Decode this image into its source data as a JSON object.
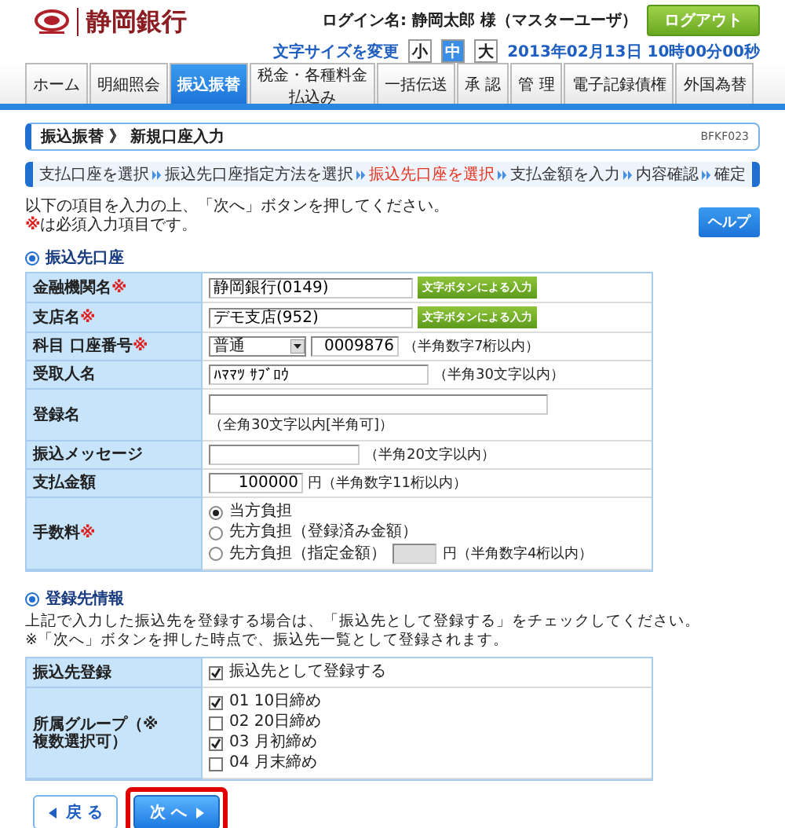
{
  "header": {
    "bank_name": "静岡銀行",
    "login_label": "ログイン名: 静岡太郎 様（マスターユーザ）",
    "logout": "ログアウト",
    "font_size_label": "文字サイズを変更",
    "font_sizes": [
      {
        "label": "小",
        "selected": false
      },
      {
        "label": "中",
        "selected": true
      },
      {
        "label": "大",
        "selected": false
      }
    ],
    "datetime": "2013年02月13日 10時00分00秒"
  },
  "nav": [
    {
      "label": "ホーム",
      "selected": false
    },
    {
      "label": "明細照会",
      "selected": false
    },
    {
      "label": "振込振替",
      "selected": true
    },
    {
      "label": "税金・各種料金払込み",
      "selected": false
    },
    {
      "label": "一括伝送",
      "selected": false
    },
    {
      "label": "承 認",
      "selected": false
    },
    {
      "label": "管 理",
      "selected": false
    },
    {
      "label": "電子記録債権",
      "selected": false
    },
    {
      "label": "外国為替",
      "selected": false
    }
  ],
  "page_title": {
    "title": "振込振替 》 新規口座入力",
    "screen_id": "BFKF023"
  },
  "steps": [
    {
      "label": "支払口座を選択",
      "current": false
    },
    {
      "label": "振込先口座指定方法を選択",
      "current": false
    },
    {
      "label": "振込先口座を選択",
      "current": true
    },
    {
      "label": "支払金額を入力",
      "current": false
    },
    {
      "label": "内容確認",
      "current": false
    },
    {
      "label": "確定",
      "current": false
    }
  ],
  "instructions": {
    "line": "以下の項目を入力の上、「次へ」ボタンを押してください。",
    "required_mark": "※",
    "required_text": "は必須入力項目です。"
  },
  "help_button": "ヘルプ",
  "account_section": {
    "heading": "振込先口座",
    "rows": [
      {
        "label": "金融機関名",
        "required_mark": "※",
        "kind": "text_button",
        "value": "静岡銀行(0149)",
        "button": "文字ボタンによる入力"
      },
      {
        "label": "支店名",
        "required_mark": "※",
        "kind": "text_button",
        "value": "デモ支店(952)",
        "button": "文字ボタンによる入力"
      },
      {
        "label": "科目 口座番号",
        "required_mark": "※",
        "kind": "account",
        "select": "普通",
        "value": "0009876",
        "hint": "（半角数字7桁以内）"
      },
      {
        "label": "受取人名",
        "kind": "text_hint",
        "value": "ﾊﾏﾏﾂ ｻﾌﾞﾛｳ",
        "hint": "（半角30文字以内）"
      },
      {
        "label": "登録名",
        "kind": "text_below",
        "hint": "（全角30文字以内[半角可]）"
      },
      {
        "label": "振込メッセージ",
        "kind": "text_hint",
        "hint": "（半角20文字以内）"
      },
      {
        "label": "支払金額",
        "kind": "amount",
        "value": "100000",
        "hint": "円（半角数字11桁以内）"
      },
      {
        "label": "手数料",
        "required_mark": "※",
        "kind": "radios",
        "options": [
          {
            "label": "当方負担",
            "selected": true
          },
          {
            "label": "先方負担（登録済み金額）",
            "selected": false
          },
          {
            "label": "先方負担（指定金額）",
            "selected": false,
            "amount_field": {
              "disabled": true
            },
            "hint": "円（半角数字4桁以内）"
          }
        ]
      }
    ]
  },
  "registration_section": {
    "heading": "登録先情報",
    "description": [
      "上記で入力した振込先を登録する場合は、「振込先として登録する」をチェックしてください。",
      "※「次へ」ボタンを押した時点で、振込先一覧として登録されます。"
    ],
    "rows": [
      {
        "label": "振込先登録",
        "options": [
          {
            "label": "振込先として登録する",
            "checked": true
          }
        ]
      },
      {
        "label": "所属グループ（※複数選択可）",
        "options": [
          {
            "label": "01 10日締め",
            "checked": true
          },
          {
            "label": "02 20日締め",
            "checked": false
          },
          {
            "label": "03 月初締め",
            "checked": true
          },
          {
            "label": "04 月末締め",
            "checked": false
          }
        ]
      }
    ]
  },
  "buttons": [
    {
      "kind": "back",
      "label": "戻 る",
      "highlighted": false
    },
    {
      "kind": "next",
      "label": "次 へ",
      "highlighted": true
    }
  ]
}
